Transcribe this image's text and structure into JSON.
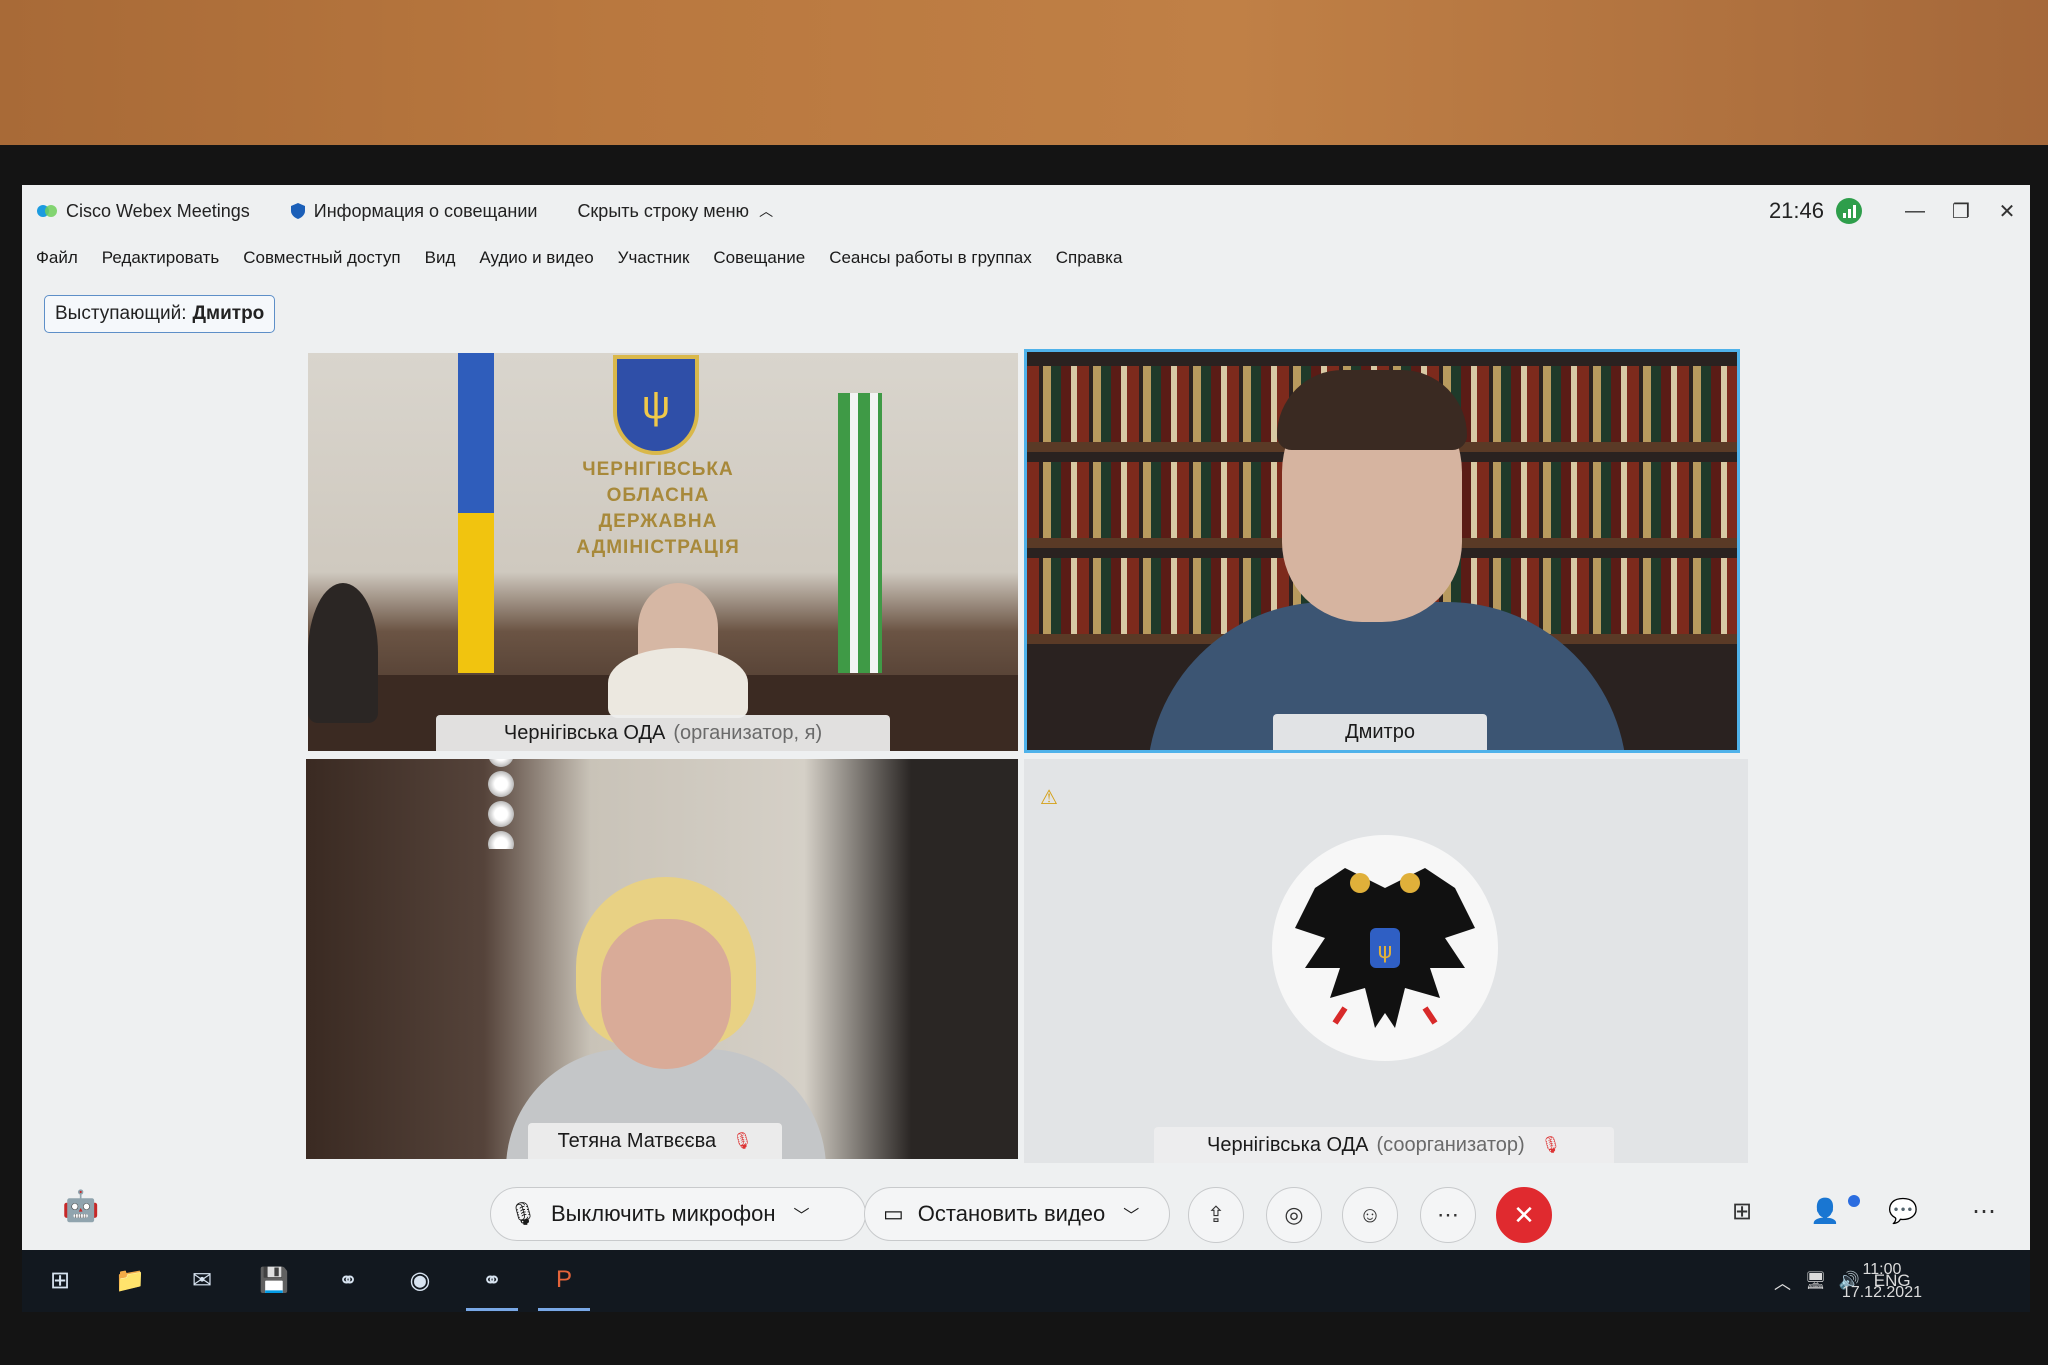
{
  "titlebar": {
    "app_name": "Cisco Webex Meetings",
    "meeting_info": "Информация о совещании",
    "hide_menu": "Скрыть строку меню",
    "clock": "21:46"
  },
  "menu": [
    "Файл",
    "Редактировать",
    "Совместный доступ",
    "Вид",
    "Аудио и видео",
    "Участник",
    "Совещание",
    "Сеансы работы в группах",
    "Справка"
  ],
  "speaker": {
    "label": "Выступающий:",
    "name": "Дмитро"
  },
  "tiles": {
    "t1": {
      "name": "Чернігівська ОДА",
      "role": "(организатор, я)",
      "wall_text": [
        "ЧЕРНІГІВСЬКА",
        "ОБЛАСНА",
        "ДЕРЖАВНА",
        "АДМІНІСТРАЦІЯ"
      ]
    },
    "t2": {
      "name": "Дмитро"
    },
    "t3": {
      "name": "Тетяна Матвєєва"
    },
    "t4": {
      "name": "Чернігівська ОДА",
      "role": "(соорганизатор)"
    }
  },
  "controls": {
    "mute_label": "Выключить микрофон",
    "video_label": "Остановить видео"
  },
  "taskbar": {
    "lang": "ENG",
    "time": "11:00",
    "date": "17.12.2021"
  },
  "colors": {
    "active_speaker_border": "#4fb2ea",
    "end_call": "#e02a2f",
    "signal": "#2e9e4b"
  }
}
